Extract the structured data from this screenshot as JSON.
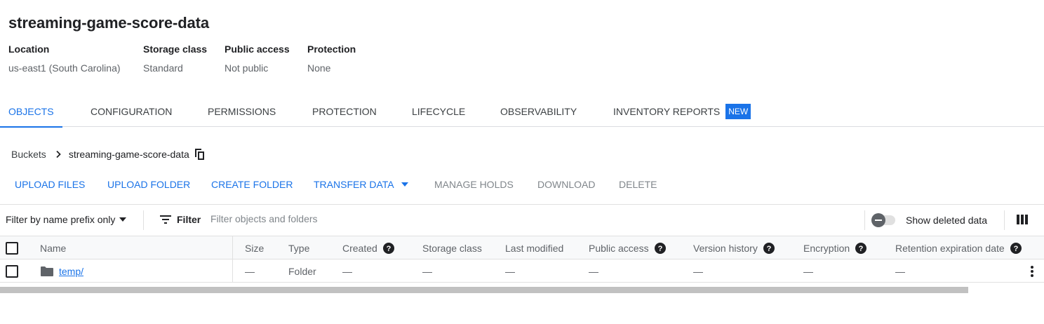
{
  "bucket": {
    "title": "streaming-game-score-data",
    "meta": [
      {
        "label": "Location",
        "value": "us-east1 (South Carolina)"
      },
      {
        "label": "Storage class",
        "value": "Standard"
      },
      {
        "label": "Public access",
        "value": "Not public"
      },
      {
        "label": "Protection",
        "value": "None"
      }
    ]
  },
  "tabs": [
    {
      "label": "OBJECTS",
      "active": true
    },
    {
      "label": "CONFIGURATION"
    },
    {
      "label": "PERMISSIONS"
    },
    {
      "label": "PROTECTION"
    },
    {
      "label": "LIFECYCLE"
    },
    {
      "label": "OBSERVABILITY"
    },
    {
      "label": "INVENTORY REPORTS",
      "badge": "NEW"
    }
  ],
  "breadcrumb": {
    "root": "Buckets",
    "current": "streaming-game-score-data",
    "separator_icon": "chevron-right-icon",
    "copy_icon": "copy-icon"
  },
  "actions": {
    "upload_files": "UPLOAD FILES",
    "upload_folder": "UPLOAD FOLDER",
    "create_folder": "CREATE FOLDER",
    "transfer_data": "TRANSFER DATA",
    "manage_holds": "MANAGE HOLDS",
    "download": "DOWNLOAD",
    "delete": "DELETE"
  },
  "filter_bar": {
    "prefix_select": "Filter by name prefix only",
    "filter_label": "Filter",
    "placeholder": "Filter objects and folders",
    "show_deleted_label": "Show deleted data",
    "show_deleted_on": false
  },
  "table": {
    "columns": {
      "name": "Name",
      "size": "Size",
      "type": "Type",
      "created": "Created",
      "storage_class": "Storage class",
      "last_modified": "Last modified",
      "public_access": "Public access",
      "version_history": "Version history",
      "encryption": "Encryption",
      "retention": "Retention expiration date"
    },
    "rows": [
      {
        "name": "temp/",
        "size": "—",
        "type": "Folder",
        "created": "—",
        "storage_class": "—",
        "last_modified": "—",
        "public_access": "—",
        "version_history": "—",
        "encryption": "—",
        "retention": "—"
      }
    ]
  },
  "colors": {
    "accent": "#1a73e8",
    "text": "#202124",
    "muted": "#5f6368",
    "disabled": "#80868b",
    "badge_bg": "#1a73e8"
  }
}
